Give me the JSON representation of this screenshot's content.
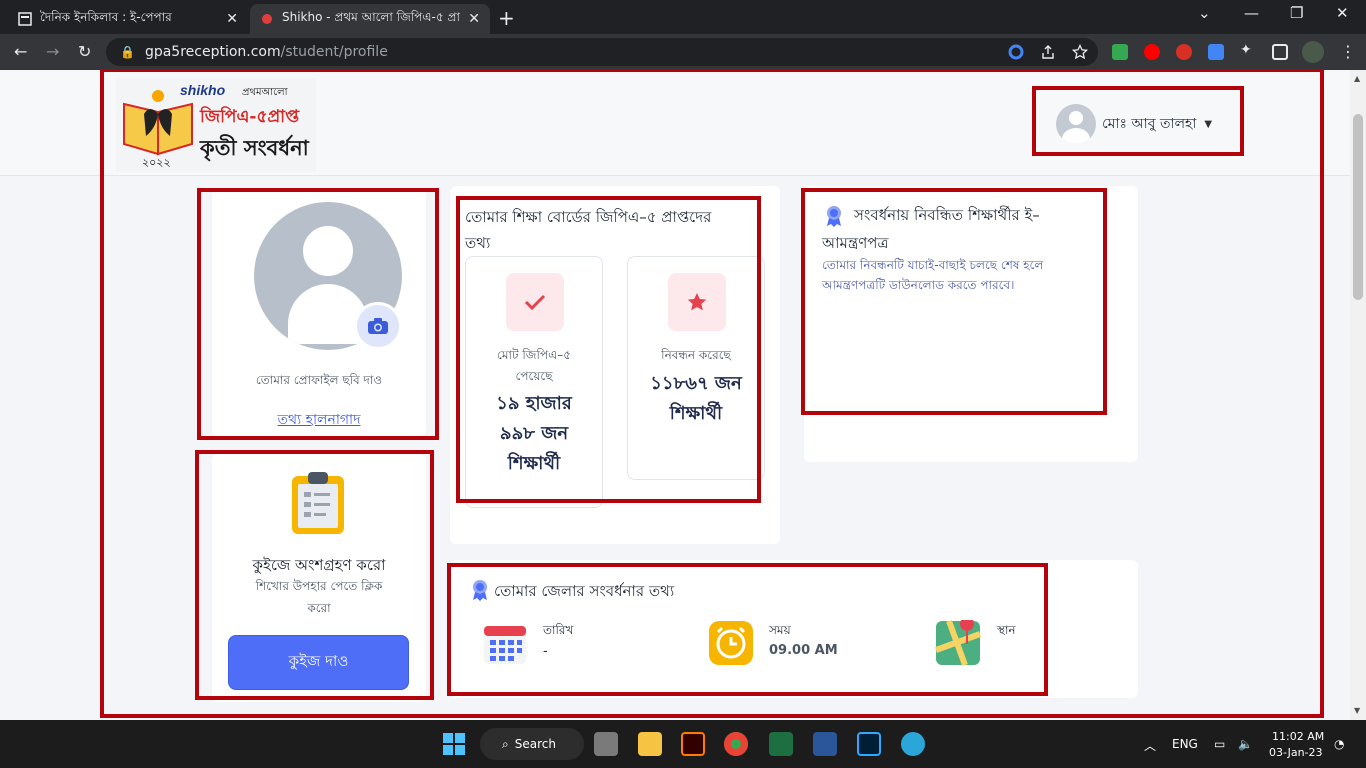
{
  "browser": {
    "tabs": [
      {
        "title": "দৈনিক ইনকিলাব : ই-পেপার"
      },
      {
        "title": "Shikho - প্রথম আলো জিপিএ-৫ প্রা"
      }
    ],
    "url_host": "gpa5reception.com",
    "url_path": "/student/profile"
  },
  "header": {
    "logo": {
      "brand": "shikho",
      "partner": "প্রথমআলো",
      "line1": "জিপিএ-৫প্রাপ্ত",
      "line2": "কৃতী সংবর্ধনা",
      "year": "২০২২"
    },
    "user_name": "মোঃ আবু তালহা"
  },
  "profile": {
    "photo_prompt": "তোমার প্রোফাইল ছবি দাও",
    "update_link": "তথ্য হালনাগাদ"
  },
  "quiz": {
    "title": "কুইজে অংশগ্রহণ করো",
    "subtitle_line1": "শিখোর উপহার পেতে ক্লিক",
    "subtitle_line2": "করো",
    "button": "কুইজ দাও"
  },
  "board_info": {
    "title_line1": "তোমার শিক্ষা বোর্ডের জিপিএ–৫ প্রাপ্তদের",
    "title_line2": "তথ্য",
    "stats": [
      {
        "label_line1": "মোট জিপিএ–৫",
        "label_line2": "পেয়েছে",
        "value_line1": "১৯ হাজার",
        "value_line2": "৯৯৮ জন",
        "value_line3": "শিক্ষার্থী"
      },
      {
        "label_line1": "নিবন্ধন করেছে",
        "value_line1": "১১৮৬৭ জন",
        "value_line2": "শিক্ষার্থী"
      }
    ]
  },
  "invitation": {
    "title_line1": "সংবর্ধনায় নিবন্ধিত শিক্ষার্থীর ই–",
    "title_line2": "আমন্ত্রণপত্র",
    "desc_line1": "তোমার নিবন্ধনটি যাচাই-বাছাই চলছে শেষ হলে",
    "desc_line2": "আমন্ত্রণপত্রটি ডাউনলোড করতে পারবে।"
  },
  "district": {
    "title": "তোমার জেলার সংবর্ধনার তথ্য",
    "items": [
      {
        "label": "তারিখ",
        "value": "-",
        "icon": "calendar-icon"
      },
      {
        "label": "সময়",
        "value": "09.00 AM",
        "icon": "clock-icon"
      },
      {
        "label": "স্থান",
        "value": "",
        "icon": "map-icon"
      }
    ]
  },
  "taskbar": {
    "search": "Search",
    "lang": "ENG",
    "time": "11:02 AM",
    "date": "03-Jan-23"
  },
  "colors": {
    "highlight": "#b3040c",
    "accent": "#4f6ef7",
    "title_navy": "#1f2a4e"
  }
}
